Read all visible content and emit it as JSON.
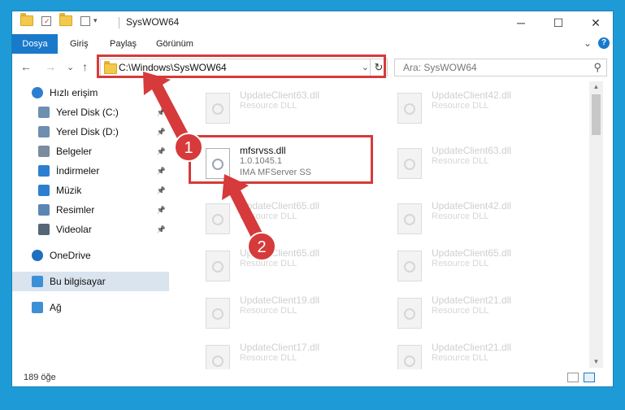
{
  "window": {
    "title": "SysWOW64",
    "controls": {
      "minimize": "─",
      "maximize": "☐",
      "close": "✕"
    }
  },
  "ribbon": {
    "tabs": [
      "Dosya",
      "Giriş",
      "Paylaş",
      "Görünüm"
    ],
    "expand": "⌄",
    "help": "?"
  },
  "nav": {
    "back": "←",
    "forward": "→",
    "recent": "⌄",
    "up": "↑",
    "address": "C:\\Windows\\SysWOW64",
    "address_dropdown": "⌄",
    "refresh": "↻",
    "search_placeholder": "Ara: SysWOW64",
    "search_icon": "⚲"
  },
  "sidebar": {
    "items": [
      {
        "label": "Hızlı erişim",
        "icon": "star-icon",
        "pinned": false,
        "indent": 0
      },
      {
        "label": "Yerel Disk (C:)",
        "icon": "drive-icon",
        "pinned": true,
        "indent": 1
      },
      {
        "label": "Yerel Disk (D:)",
        "icon": "drive-icon",
        "pinned": true,
        "indent": 1
      },
      {
        "label": "Belgeler",
        "icon": "documents-icon",
        "pinned": true,
        "indent": 1
      },
      {
        "label": "İndirmeler",
        "icon": "download-icon",
        "pinned": true,
        "indent": 1
      },
      {
        "label": "Müzik",
        "icon": "music-icon",
        "pinned": true,
        "indent": 1
      },
      {
        "label": "Resimler",
        "icon": "pictures-icon",
        "pinned": true,
        "indent": 1
      },
      {
        "label": "Videolar",
        "icon": "videos-icon",
        "pinned": true,
        "indent": 1
      },
      {
        "label": "OneDrive",
        "icon": "cloud-icon",
        "pinned": false,
        "indent": 0
      },
      {
        "label": "Bu bilgisayar",
        "icon": "computer-icon",
        "pinned": false,
        "indent": 0
      },
      {
        "label": "Ağ",
        "icon": "network-icon",
        "pinned": false,
        "indent": 0
      }
    ]
  },
  "files": {
    "left": [
      {
        "name": "UpdateClient63.dll",
        "desc": "Resource DLL"
      },
      {
        "name": "mfsrvss.dll",
        "desc": "1.0.1045.1",
        "extra": "IMA MFServer SS"
      },
      {
        "name": "UpdateClient65.dll",
        "desc": "Resource DLL"
      },
      {
        "name": "UpdateClient65.dll",
        "desc": "Resource DLL"
      },
      {
        "name": "UpdateClient19.dll",
        "desc": "Resource DLL"
      },
      {
        "name": "UpdateClient17.dll",
        "desc": "Resource DLL"
      }
    ],
    "right": [
      {
        "name": "UpdateClient42.dll",
        "desc": "Resource DLL"
      },
      {
        "name": "UpdateClient63.dll",
        "desc": "Resource DLL"
      },
      {
        "name": "UpdateClient42.dll",
        "desc": "Resource DLL"
      },
      {
        "name": "UpdateClient65.dll",
        "desc": "Resource DLL"
      },
      {
        "name": "UpdateClient21.dll",
        "desc": "Resource DLL"
      },
      {
        "name": "UpdateClient21.dll",
        "desc": "Resource DLL"
      }
    ]
  },
  "status": {
    "count": "189 öğe"
  },
  "annotations": {
    "step1": "1",
    "step2": "2"
  },
  "colors": {
    "accent": "#1979ca",
    "highlight": "#d63a3a",
    "selected": "#d9e4ef"
  }
}
